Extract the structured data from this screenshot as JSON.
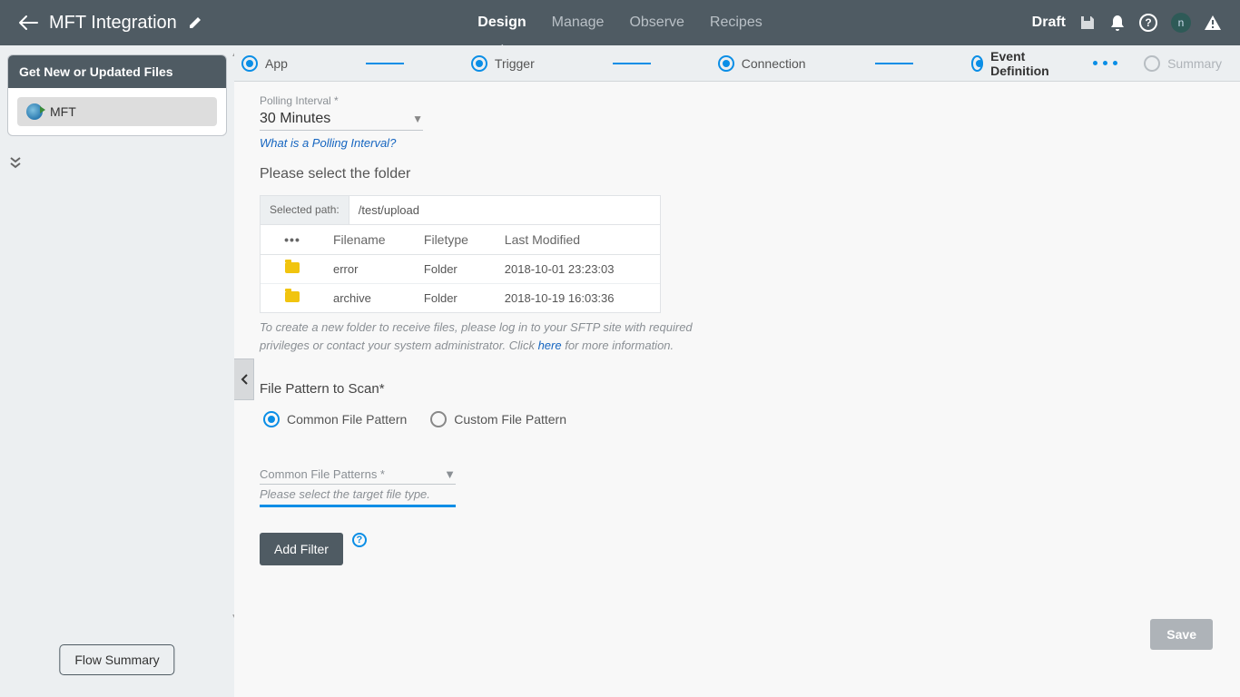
{
  "header": {
    "title": "MFT Integration",
    "tabs": [
      "Design",
      "Manage",
      "Observe",
      "Recipes"
    ],
    "active_tab": 0,
    "status": "Draft",
    "avatar_letter": "n"
  },
  "sidebar": {
    "card_title": "Get New or Updated Files",
    "items": [
      {
        "label": "MFT"
      }
    ],
    "flow_summary_label": "Flow Summary"
  },
  "stepper": {
    "steps": [
      {
        "label": "App",
        "state": "done"
      },
      {
        "label": "Trigger",
        "state": "done"
      },
      {
        "label": "Connection",
        "state": "done"
      },
      {
        "label": "Event Definition",
        "state": "active"
      },
      {
        "label": "Summary",
        "state": "pending"
      }
    ]
  },
  "form": {
    "polling": {
      "label": "Polling Interval *",
      "value": "30 Minutes",
      "help": "What is a Polling Interval?"
    },
    "folder_section_title": "Please select the folder",
    "path_label": "Selected path:",
    "path_value": "/test/upload",
    "columns": {
      "icon": "•••",
      "filename": "Filename",
      "filetype": "Filetype",
      "last_modified": "Last Modified"
    },
    "rows": [
      {
        "filename": "error",
        "filetype": "Folder",
        "last_modified": "2018-10-01 23:23:03"
      },
      {
        "filename": "archive",
        "filetype": "Folder",
        "last_modified": "2018-10-19 16:03:36"
      }
    ],
    "folder_note_pre": "To create a new folder to receive files, please log in to your SFTP site with required privileges or contact your system administrator. Click ",
    "folder_note_link": "here",
    "folder_note_post": " for more information.",
    "pattern_title": "File Pattern to Scan*",
    "radios": {
      "common": "Common File Pattern",
      "custom": "Custom File Pattern"
    },
    "pattern_select_label": "Common File Patterns *",
    "pattern_select_help": "Please select the target file type.",
    "add_filter_label": "Add Filter",
    "save_label": "Save"
  }
}
